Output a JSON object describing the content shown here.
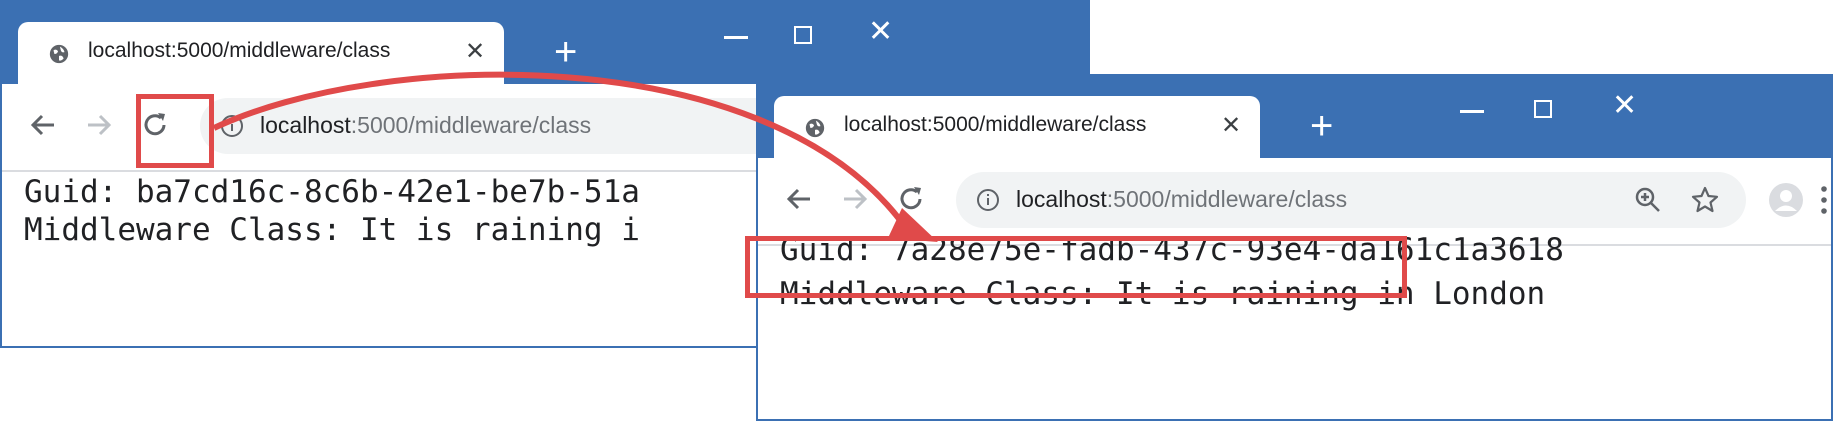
{
  "back_window": {
    "tab_title": "localhost:5000/middleware/class",
    "url_host": "localhost",
    "url_rest": ":5000/middleware/class",
    "content": {
      "guid_line": "Guid: ba7cd16c-8c6b-42e1-be7b-51a",
      "message_line": "Middleware Class: It is raining i"
    }
  },
  "front_window": {
    "tab_title": "localhost:5000/middleware/class",
    "url_host": "localhost",
    "url_rest": ":5000/middleware/class",
    "content": {
      "guid_line": "Guid: 7a28e75e-fadb-437c-93e4-da161c1a3618",
      "message_line": "Middleware Class: It is raining in London"
    }
  },
  "icons": {
    "tab": "globe-icon",
    "new_tab": "plus-icon",
    "minimize": "minimize-icon",
    "maximize": "maximize-icon",
    "close": "close-icon",
    "back": "back-arrow-icon",
    "forward": "forward-arrow-icon",
    "reload": "reload-icon",
    "site_info": "info-icon",
    "zoom": "zoom-icon",
    "bookmark": "star-icon",
    "profile": "profile-avatar-icon",
    "menu": "kebab-menu-icon"
  },
  "colors": {
    "titlebar": "#3b70b3",
    "highlight": "#e04a4a",
    "omnibox": "#f1f3f4"
  }
}
